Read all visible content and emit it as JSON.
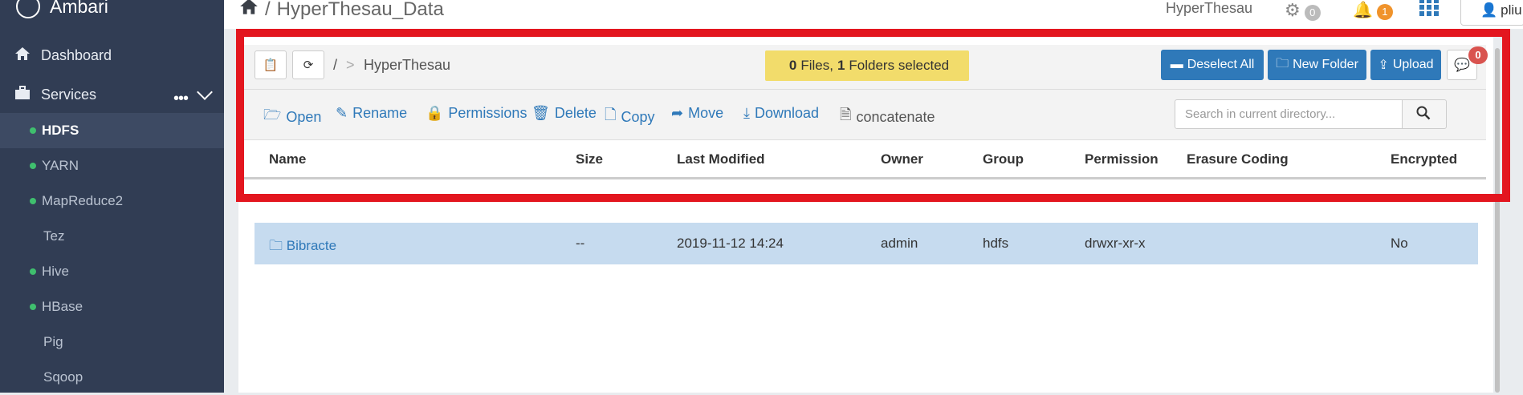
{
  "sidebar": {
    "brand": "Ambari",
    "nav": [
      {
        "label": "Dashboard",
        "icon": "home-icon"
      },
      {
        "label": "Services",
        "icon": "briefcase-icon"
      }
    ],
    "services": [
      {
        "label": "HDFS",
        "status": "started",
        "active": true
      },
      {
        "label": "YARN",
        "status": "started"
      },
      {
        "label": "MapReduce2",
        "status": "started"
      },
      {
        "label": "Tez",
        "status": "none"
      },
      {
        "label": "Hive",
        "status": "started"
      },
      {
        "label": "HBase",
        "status": "started"
      },
      {
        "label": "Pig",
        "status": "none"
      },
      {
        "label": "Sqoop",
        "status": "none"
      }
    ]
  },
  "topbar": {
    "breadcrumb_sep": "/",
    "breadcrumb_title": "HyperThesau_Data",
    "cluster_name": "HyperThesau",
    "settings_count": "0",
    "alerts_count": "1",
    "user": "pliu"
  },
  "toolbar": {
    "path_root": "/",
    "path_sep": ">",
    "path_current": "HyperThesau",
    "selection": {
      "files": "0",
      "files_label": "Files,",
      "folders": "1",
      "folders_label": "Folders selected"
    },
    "deselect_all": "Deselect All",
    "new_folder": "New Folder",
    "upload": "Upload",
    "chat_count": "0"
  },
  "actions": {
    "open": "Open",
    "rename": "Rename",
    "permissions": "Permissions",
    "delete": "Delete",
    "copy": "Copy",
    "move": "Move",
    "download": "Download",
    "concatenate": "concatenate"
  },
  "search": {
    "placeholder": "Search in current directory..."
  },
  "table": {
    "columns": [
      "Name",
      "Size",
      "Last Modified",
      "Owner",
      "Group",
      "Permission",
      "Erasure Coding",
      "Encrypted"
    ],
    "rows": [
      {
        "name": "Bibracte",
        "size": "--",
        "modified": "2019-11-12 14:24",
        "owner": "admin",
        "group": "hdfs",
        "permission": "drwxr-xr-x",
        "erasure": "",
        "encrypted": "No"
      }
    ]
  },
  "colors": {
    "sidebar": "#313d54",
    "primary": "#2f79b9",
    "highlight": "#e3161f",
    "selection": "#f2dc6b",
    "row_selected": "#c6dbef"
  }
}
